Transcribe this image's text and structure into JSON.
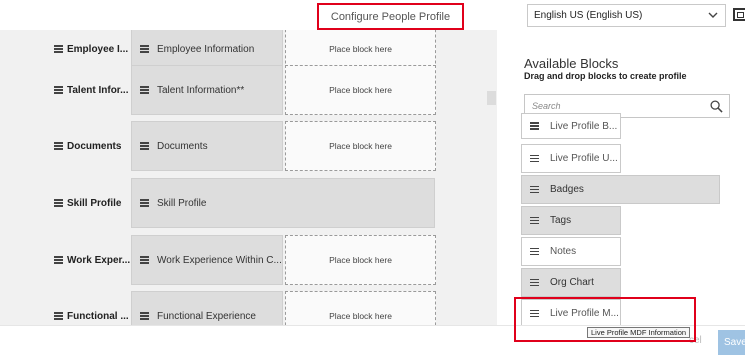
{
  "header": {
    "title": "Configure People Profile",
    "language": "English US (English US)"
  },
  "canvas": {
    "placeholder_text": "Place block here",
    "rows": [
      {
        "label": "Employee I...",
        "block": "Employee Information",
        "has_placeholder": true,
        "wide": false
      },
      {
        "label": "Talent Infor...",
        "block": "Talent Information**",
        "has_placeholder": true,
        "wide": false
      },
      {
        "label": "Documents",
        "block": "Documents",
        "has_placeholder": true,
        "wide": false
      },
      {
        "label": "Skill Profile",
        "block": "Skill Profile",
        "has_placeholder": false,
        "wide": true
      },
      {
        "label": "Work Exper...",
        "block": "Work Experience Within C...",
        "has_placeholder": true,
        "wide": false
      },
      {
        "label": "Functional ...",
        "block": "Functional Experience",
        "has_placeholder": true,
        "wide": false
      }
    ]
  },
  "panel": {
    "title": "Available Blocks",
    "subtitle": "Drag and drop blocks to create profile",
    "search_placeholder": "Search",
    "blocks": [
      {
        "label": "Live Profile B...",
        "style": "white"
      },
      {
        "label": "Live Profile U...",
        "style": "white"
      },
      {
        "label": "Badges",
        "style": "grey"
      },
      {
        "label": "Tags",
        "style": "grey"
      },
      {
        "label": "Notes",
        "style": "white"
      },
      {
        "label": "Org Chart",
        "style": "grey"
      },
      {
        "label": "Live Profile M...",
        "style": "white"
      }
    ],
    "tooltip": "Live Profile MDF Information"
  },
  "footer": {
    "cancel_label": "cel",
    "save_label": "Save"
  },
  "colors": {
    "highlight": "#e0001b",
    "block_grey": "#dddddd",
    "save_button": "#9fc3e3"
  }
}
